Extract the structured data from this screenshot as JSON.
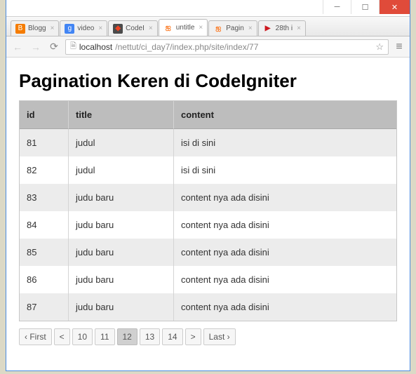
{
  "browser": {
    "tabs": [
      {
        "label": "Blogg",
        "icon": "blogger"
      },
      {
        "label": "video",
        "icon": "google"
      },
      {
        "label": "CodeI",
        "icon": "ci"
      },
      {
        "label": "untitle",
        "icon": "xampp",
        "active": true
      },
      {
        "label": "Pagin",
        "icon": "xampp"
      },
      {
        "label": "28th i",
        "icon": "yt"
      }
    ],
    "url_host": "localhost",
    "url_path": "/nettut/ci_day7/index.php/site/index/77"
  },
  "page": {
    "title": "Pagination Keren di CodeIgniter",
    "columns": {
      "id": "id",
      "title": "title",
      "content": "content"
    },
    "rows": [
      {
        "id": "81",
        "title": "judul",
        "content": "isi di sini"
      },
      {
        "id": "82",
        "title": "judul",
        "content": "isi di sini"
      },
      {
        "id": "83",
        "title": "judu baru",
        "content": "content nya ada disini"
      },
      {
        "id": "84",
        "title": "judu baru",
        "content": "content nya ada disini"
      },
      {
        "id": "85",
        "title": "judu baru",
        "content": "content nya ada disini"
      },
      {
        "id": "86",
        "title": "judu baru",
        "content": "content nya ada disini"
      },
      {
        "id": "87",
        "title": "judu baru",
        "content": "content nya ada disini"
      }
    ],
    "pagination": {
      "first": "‹ First",
      "prev": "<",
      "pages": [
        "10",
        "11",
        "12",
        "13",
        "14"
      ],
      "current": "12",
      "next": ">",
      "last": "Last ›"
    }
  }
}
